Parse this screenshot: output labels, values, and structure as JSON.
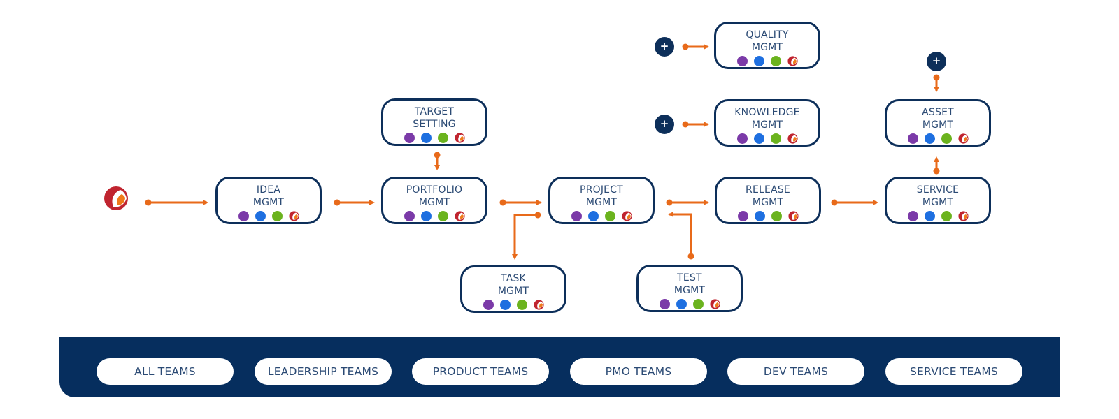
{
  "colors": {
    "navy": "#0d2f5a",
    "band": "#062e5e",
    "arrow": "#e86a1a",
    "text": "#2b4a74",
    "dot_purple": "#7b3aa8",
    "dot_blue": "#1e6fe0",
    "dot_green": "#6bb31e",
    "brand_red": "#c0242f",
    "brand_orange": "#ef7a1a"
  },
  "start_icon": "brand-logo-icon",
  "add_icon": "+",
  "nodes": {
    "idea": {
      "line1": "IDEA",
      "line2": "MGMT"
    },
    "target": {
      "line1": "TARGET",
      "line2": "SETTING"
    },
    "portfolio": {
      "line1": "PORTFOLIO",
      "line2": "MGMT"
    },
    "project": {
      "line1": "PROJECT",
      "line2": "MGMT"
    },
    "task": {
      "line1": "TASK",
      "line2": "MGMT"
    },
    "test": {
      "line1": "TEST",
      "line2": "MGMT"
    },
    "release": {
      "line1": "RELEASE",
      "line2": "MGMT"
    },
    "quality": {
      "line1": "QUALITY",
      "line2": "MGMT"
    },
    "knowledge": {
      "line1": "KNOWLEDGE",
      "line2": "MGMT"
    },
    "asset": {
      "line1": "ASSET",
      "line2": "MGMT"
    },
    "service": {
      "line1": "SERVICE",
      "line2": "MGMT"
    }
  },
  "node_dots": [
    "purple",
    "blue",
    "green",
    "brand"
  ],
  "connections": [
    {
      "from": "start",
      "to": "idea"
    },
    {
      "from": "idea",
      "to": "portfolio"
    },
    {
      "from": "target",
      "to": "portfolio"
    },
    {
      "from": "portfolio",
      "to": "project"
    },
    {
      "from": "project",
      "to": "task"
    },
    {
      "from": "project",
      "to": "release"
    },
    {
      "from": "test",
      "to": "project"
    },
    {
      "from": "release",
      "to": "service"
    },
    {
      "from": "add",
      "to": "quality"
    },
    {
      "from": "add",
      "to": "knowledge"
    },
    {
      "from": "add",
      "to": "asset"
    },
    {
      "from": "service",
      "to": "asset"
    }
  ],
  "teams": [
    "ALL TEAMS",
    "LEADERSHIP TEAMS",
    "PRODUCT TEAMS",
    "PMO TEAMS",
    "DEV TEAMS",
    "SERVICE TEAMS"
  ]
}
